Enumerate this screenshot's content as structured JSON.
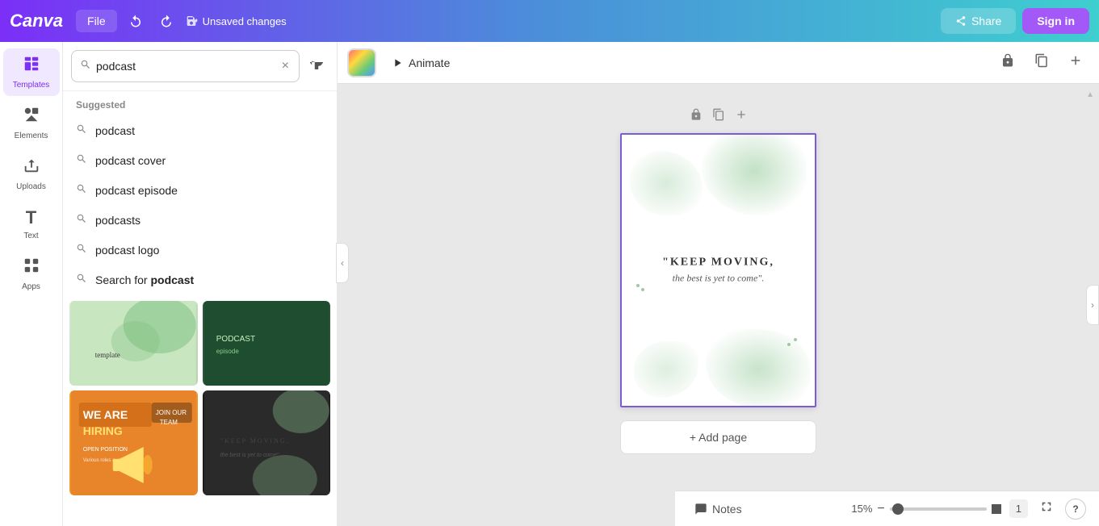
{
  "app": {
    "logo": "Canva",
    "title": "Unsaved changes"
  },
  "topbar": {
    "file_label": "File",
    "undo_icon": "↩",
    "redo_icon": "↪",
    "unsaved_label": "Unsaved changes",
    "share_label": "Share",
    "signin_label": "Sign in"
  },
  "sidebar": {
    "items": [
      {
        "id": "templates",
        "label": "Templates",
        "icon": "⊞"
      },
      {
        "id": "elements",
        "label": "Elements",
        "icon": "✦"
      },
      {
        "id": "uploads",
        "label": "Uploads",
        "icon": "⬆"
      },
      {
        "id": "text",
        "label": "Text",
        "icon": "T"
      },
      {
        "id": "apps",
        "label": "Apps",
        "icon": "⊙"
      }
    ]
  },
  "search": {
    "placeholder": "Search for podcast",
    "current_value": "podcast",
    "filter_icon": "filter",
    "clear_icon": "×"
  },
  "suggestions": {
    "label": "Suggested",
    "items": [
      {
        "text": "podcast"
      },
      {
        "text": "podcast cover"
      },
      {
        "text": "podcast episode"
      },
      {
        "text": "podcasts"
      },
      {
        "text": "podcast logo"
      },
      {
        "text": "Search for podcast",
        "bold_part": "podcast",
        "is_search": true
      }
    ]
  },
  "canvas": {
    "animate_label": "Animate",
    "page_quote_main": "\"KEEP MOVING,",
    "page_quote_sub": "the best is yet to come\".",
    "add_page_label": "+ Add page"
  },
  "bottombar": {
    "notes_label": "Notes",
    "zoom_percent": "15%",
    "page_number": "1",
    "expand_icon": "⤢",
    "help_icon": "?"
  }
}
